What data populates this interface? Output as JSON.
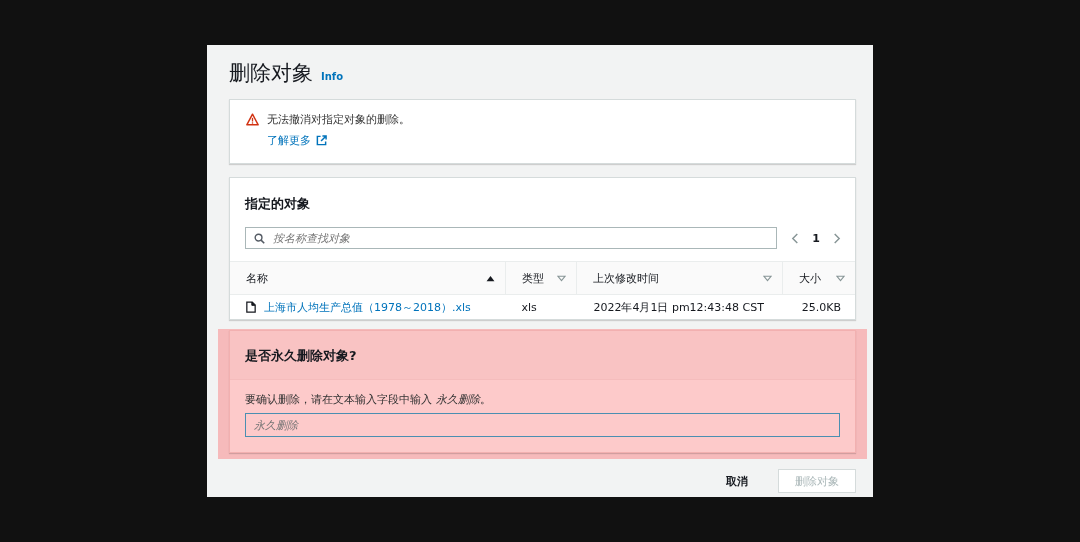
{
  "dialog": {
    "title": "删除对象",
    "info_link": "Info"
  },
  "alert": {
    "message": "无法撤消对指定对象的删除。",
    "link": "了解更多"
  },
  "objects": {
    "title": "指定的对象",
    "search": {
      "placeholder": "按名称查找对象"
    },
    "pagination": {
      "page": "1"
    },
    "columns": [
      {
        "label": "名称",
        "sorted": true
      },
      {
        "label": "类型",
        "sorted": false
      },
      {
        "label": "上次修改时间",
        "sorted": false
      },
      {
        "label": "大小",
        "sorted": false
      }
    ],
    "rows": [
      {
        "name": "上海市人均生产总值（1978～2018）.xls",
        "type": "xls",
        "modified": "2022年4月1日 pm12:43:48 CST",
        "size": "25.0KB"
      }
    ]
  },
  "confirm": {
    "title": "是否永久删除对象?",
    "instruction": "要确认删除，请在文本输入字段中输入 *永久删除*。",
    "field": {
      "placeholder": "永久删除"
    },
    "highlighted": true
  },
  "buttons": [
    {
      "label": "取消",
      "kind": "cancel",
      "disabled": false
    },
    {
      "label": "删除对象",
      "kind": "primary",
      "disabled": true
    }
  ]
}
